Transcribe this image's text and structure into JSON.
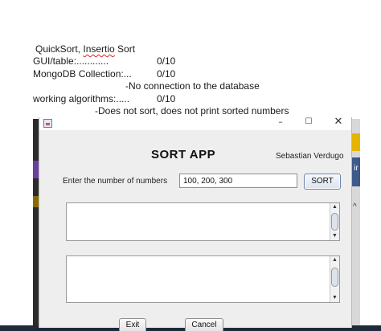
{
  "notes": {
    "line1_prefix": "QuickSort, ",
    "line1_misspelled": "Insertio",
    "line1_suffix": " Sort",
    "gui_label": "GUI/table:............",
    "gui_score": "0/10",
    "mongo_label": "MongoDB Collection:...",
    "mongo_score": "0/10",
    "mongo_comment": "-No connection to the database",
    "algo_label": "working algorithms:.....",
    "algo_score": "0/10",
    "algo_comment": "-Does not sort, does not print sorted numbers"
  },
  "window": {
    "controls": {
      "minimize": "–",
      "maximize": "☐",
      "close": "✕"
    },
    "title": "SORT APP",
    "author": "Sebastian Verdugo",
    "prompt_label": "Enter the number of numbers",
    "number_input_value": "100, 200, 300",
    "sort_button": "SORT",
    "output_area_1": "",
    "output_area_2": "",
    "scroll_up": "▲",
    "scroll_down": "▼",
    "exit_button": "Exit",
    "cancel_button": "Cancel"
  },
  "background": {
    "right_edge_text": "ir",
    "right_edge_chevron": "^"
  },
  "colors": {
    "window_bg": "#eeeeee",
    "taskbar": "#1e2a3a",
    "spell_error": "#dd2222"
  }
}
